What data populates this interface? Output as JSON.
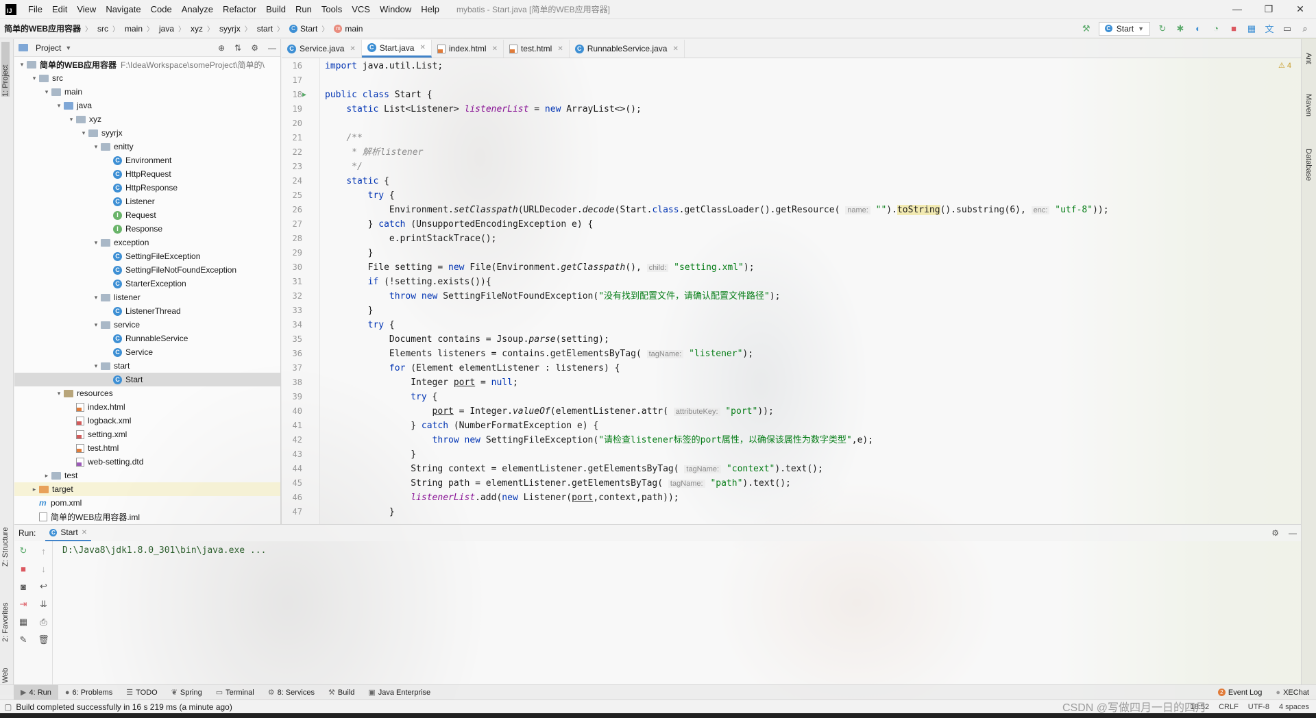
{
  "menubar": {
    "items": [
      "File",
      "Edit",
      "View",
      "Navigate",
      "Code",
      "Analyze",
      "Refactor",
      "Build",
      "Run",
      "Tools",
      "VCS",
      "Window",
      "Help"
    ],
    "title": "mybatis - Start.java [简单的WEB应用容器]",
    "minimize": "—",
    "maximize": "❐",
    "close": "✕"
  },
  "navbar": {
    "breadcrumbs": [
      "简单的WEB应用容器",
      "src",
      "main",
      "java",
      "xyz",
      "syyrjx",
      "start",
      "Start",
      "main"
    ],
    "run_config": "Start"
  },
  "left_strip": {
    "project": "1: Project",
    "structure": "Z: Structure",
    "favorites": "2: Favorites",
    "web": "Web"
  },
  "right_strip": {
    "ant": "Ant",
    "maven": "Maven",
    "database": "Database"
  },
  "project_panel": {
    "title": "Project",
    "tree": [
      {
        "label": "简单的WEB应用容器",
        "path": "F:\\IdeaWorkspace\\someProject\\简单的\\",
        "depth": 0,
        "icon": "folder",
        "arrow": "▾",
        "bold": true
      },
      {
        "label": "src",
        "depth": 1,
        "icon": "folder",
        "arrow": "▾"
      },
      {
        "label": "main",
        "depth": 2,
        "icon": "folder",
        "arrow": "▾"
      },
      {
        "label": "java",
        "depth": 3,
        "icon": "folder-src",
        "arrow": "▾"
      },
      {
        "label": "xyz",
        "depth": 4,
        "icon": "folder",
        "arrow": "▾"
      },
      {
        "label": "syyrjx",
        "depth": 5,
        "icon": "folder",
        "arrow": "▾"
      },
      {
        "label": "enitty",
        "depth": 6,
        "icon": "folder",
        "arrow": "▾"
      },
      {
        "label": "Environment",
        "depth": 7,
        "icon": "class"
      },
      {
        "label": "HttpRequest",
        "depth": 7,
        "icon": "class"
      },
      {
        "label": "HttpResponse",
        "depth": 7,
        "icon": "class"
      },
      {
        "label": "Listener",
        "depth": 7,
        "icon": "class"
      },
      {
        "label": "Request",
        "depth": 7,
        "icon": "interface"
      },
      {
        "label": "Response",
        "depth": 7,
        "icon": "interface"
      },
      {
        "label": "exception",
        "depth": 6,
        "icon": "folder",
        "arrow": "▾"
      },
      {
        "label": "SettingFileException",
        "depth": 7,
        "icon": "class"
      },
      {
        "label": "SettingFileNotFoundException",
        "depth": 7,
        "icon": "class"
      },
      {
        "label": "StarterException",
        "depth": 7,
        "icon": "class"
      },
      {
        "label": "listener",
        "depth": 6,
        "icon": "folder",
        "arrow": "▾"
      },
      {
        "label": "ListenerThread",
        "depth": 7,
        "icon": "class"
      },
      {
        "label": "service",
        "depth": 6,
        "icon": "folder",
        "arrow": "▾"
      },
      {
        "label": "RunnableService",
        "depth": 7,
        "icon": "class"
      },
      {
        "label": "Service",
        "depth": 7,
        "icon": "class"
      },
      {
        "label": "start",
        "depth": 6,
        "icon": "folder",
        "arrow": "▾"
      },
      {
        "label": "Start",
        "depth": 7,
        "icon": "class",
        "selected": true
      },
      {
        "label": "resources",
        "depth": 3,
        "icon": "folder-res",
        "arrow": "▾"
      },
      {
        "label": "index.html",
        "depth": 4,
        "icon": "html"
      },
      {
        "label": "logback.xml",
        "depth": 4,
        "icon": "xml"
      },
      {
        "label": "setting.xml",
        "depth": 4,
        "icon": "xml"
      },
      {
        "label": "test.html",
        "depth": 4,
        "icon": "html"
      },
      {
        "label": "web-setting.dtd",
        "depth": 4,
        "icon": "dtd"
      },
      {
        "label": "test",
        "depth": 2,
        "icon": "folder",
        "arrow": "▸"
      },
      {
        "label": "target",
        "depth": 1,
        "icon": "folder-orange",
        "arrow": "▸",
        "target": true
      },
      {
        "label": "pom.xml",
        "depth": 1,
        "icon": "maven"
      },
      {
        "label": "简单的WEB应用容器.iml",
        "depth": 1,
        "icon": "file"
      }
    ]
  },
  "editor": {
    "tabs": [
      {
        "label": "Service.java",
        "icon": "class"
      },
      {
        "label": "Start.java",
        "icon": "class",
        "active": true
      },
      {
        "label": "index.html",
        "icon": "html"
      },
      {
        "label": "test.html",
        "icon": "html"
      },
      {
        "label": "RunnableService.java",
        "icon": "class"
      }
    ],
    "warnings": "⚠ 4",
    "lines": [
      {
        "n": "16",
        "html": "<span class=\"kw\">import</span> java.util.List;"
      },
      {
        "n": "17",
        "html": ""
      },
      {
        "n": "18",
        "html": "<span class=\"kw\">public class</span> Start {",
        "run": true
      },
      {
        "n": "19",
        "html": "    <span class=\"kw\">static</span> List&lt;Listener&gt; <span class=\"fld\">listenerList</span> = <span class=\"kw\">new</span> ArrayList&lt;&gt;();"
      },
      {
        "n": "20",
        "html": ""
      },
      {
        "n": "21",
        "html": "    <span class=\"cmt\">/**</span>"
      },
      {
        "n": "22",
        "html": "    <span class=\"cmt\"> * 解析listener</span>"
      },
      {
        "n": "23",
        "html": "    <span class=\"cmt\"> */</span>"
      },
      {
        "n": "24",
        "html": "    <span class=\"kw\">static</span> {"
      },
      {
        "n": "25",
        "html": "        <span class=\"kw\">try</span> {"
      },
      {
        "n": "26",
        "html": "            Environment.<span class=\"mth-i\">setClasspath</span>(URLDecoder.<span class=\"mth-i\">decode</span>(Start.<span class=\"kw\">class</span>.getClassLoader().getResource( <span class=\"hint\">name:</span> <span class=\"str\">\"\"</span>).<span class=\"hl\">toString</span>().substring(6), <span class=\"hint\">enc:</span> <span class=\"str\">\"utf-8\"</span>));"
      },
      {
        "n": "27",
        "html": "        } <span class=\"kw\">catch</span> (UnsupportedEncodingException e) {"
      },
      {
        "n": "28",
        "html": "            e.printStackTrace();"
      },
      {
        "n": "29",
        "html": "        }"
      },
      {
        "n": "30",
        "html": "        File setting = <span class=\"kw\">new</span> File(Environment.<span class=\"mth-i\">getClasspath</span>(), <span class=\"hint\">child:</span> <span class=\"str\">\"setting.xml\"</span>);"
      },
      {
        "n": "31",
        "html": "        <span class=\"kw\">if</span> (!setting.exists()){"
      },
      {
        "n": "32",
        "html": "            <span class=\"kw\">throw new</span> SettingFileNotFoundException(<span class=\"str\">\"没有找到配置文件，请确认配置文件路径\"</span>);"
      },
      {
        "n": "33",
        "html": "        }"
      },
      {
        "n": "34",
        "html": "        <span class=\"kw\">try</span> {"
      },
      {
        "n": "35",
        "html": "            Document contains = Jsoup.<span class=\"mth-i\">parse</span>(setting);"
      },
      {
        "n": "36",
        "html": "            Elements listeners = contains.getElementsByTag( <span class=\"hint\">tagName:</span> <span class=\"str\">\"listener\"</span>);"
      },
      {
        "n": "37",
        "html": "            <span class=\"kw\">for</span> (Element elementListener : listeners) {"
      },
      {
        "n": "38",
        "html": "                Integer <u>port</u> = <span class=\"kw\">null</span>;"
      },
      {
        "n": "39",
        "html": "                <span class=\"kw\">try</span> {"
      },
      {
        "n": "40",
        "html": "                    <u>port</u> = Integer.<span class=\"mth-i\">valueOf</span>(elementListener.attr( <span class=\"hint\">attributeKey:</span> <span class=\"str\">\"port\"</span>));"
      },
      {
        "n": "41",
        "html": "                } <span class=\"kw\">catch</span> (NumberFormatException e) {"
      },
      {
        "n": "42",
        "html": "                    <span class=\"kw\">throw new</span> SettingFileException(<span class=\"str\">\"请检查listener标签的port属性，以确保该属性为数字类型\"</span>,e);"
      },
      {
        "n": "43",
        "html": "                }"
      },
      {
        "n": "44",
        "html": "                String context = elementListener.getElementsByTag( <span class=\"hint\">tagName:</span> <span class=\"str\">\"context\"</span>).text();"
      },
      {
        "n": "45",
        "html": "                String path = elementListener.getElementsByTag( <span class=\"hint\">tagName:</span> <span class=\"str\">\"path\"</span>).text();"
      },
      {
        "n": "46",
        "html": "                <span class=\"fld\">listenerList</span>.add(<span class=\"kw\">new</span> Listener(<u>port</u>,context,path));"
      },
      {
        "n": "47",
        "html": "            }"
      }
    ]
  },
  "run_panel": {
    "label": "Run:",
    "tab": "Start",
    "console_line": "D:\\Java8\\jdk1.8.0_301\\bin\\java.exe ..."
  },
  "bottom_bar": {
    "items": [
      {
        "label": "4: Run",
        "icon": "▶",
        "active": true
      },
      {
        "label": "6: Problems",
        "icon": "●"
      },
      {
        "label": "TODO",
        "icon": "☰"
      },
      {
        "label": "Spring",
        "icon": "❦"
      },
      {
        "label": "Terminal",
        "icon": "▭"
      },
      {
        "label": "8: Services",
        "icon": "⚙"
      },
      {
        "label": "Build",
        "icon": "⚒"
      },
      {
        "label": "Java Enterprise",
        "icon": "▣"
      }
    ],
    "event_count": "2",
    "event_log": "Event Log",
    "xechat": "XEChat"
  },
  "status_bar": {
    "message": "Build completed successfully in 16 s 219 ms (a minute ago)",
    "position": "18:52",
    "line_sep": "CRLF",
    "encoding": "UTF-8",
    "indent": "4 spaces"
  },
  "watermark": "CSDN @写做四月一日的四月"
}
